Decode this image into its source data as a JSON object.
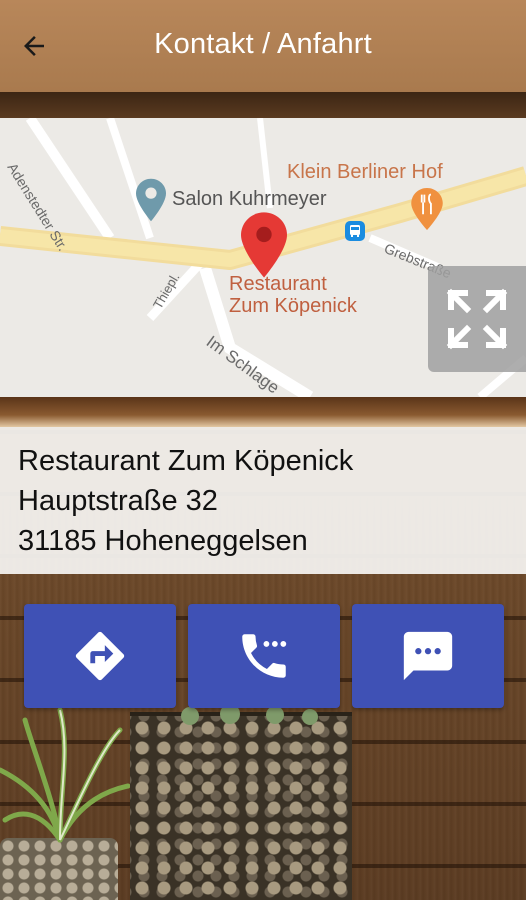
{
  "app_bar": {
    "title": "Kontakt / Anfahrt",
    "back_icon": "arrow-left-icon"
  },
  "map": {
    "labels": {
      "salon": "Salon Kuhrmeyer",
      "klein": "Klein Berliner Hof",
      "restaurant_line1": "Restaurant",
      "restaurant_line2": "Zum Köpenick",
      "street_adenstedter": "Adenstedter Str.",
      "street_grebs": "Grebstraße",
      "street_thiep": "Thiepl.",
      "street_schlage": "Im Schlage"
    },
    "fullscreen_icon": "fullscreen-icon"
  },
  "address": {
    "name": "Restaurant Zum Köpenick",
    "street": "Hauptstraße 32",
    "city": "31185 Hoheneggelsen"
  },
  "actions": [
    {
      "name": "route",
      "icon": "directions-icon"
    },
    {
      "name": "call",
      "icon": "phone-icon"
    },
    {
      "name": "message",
      "icon": "message-icon"
    }
  ],
  "colors": {
    "app_bar": "#a97a4e",
    "action_button": "#3f51b5",
    "map_pin": "#e53935"
  }
}
